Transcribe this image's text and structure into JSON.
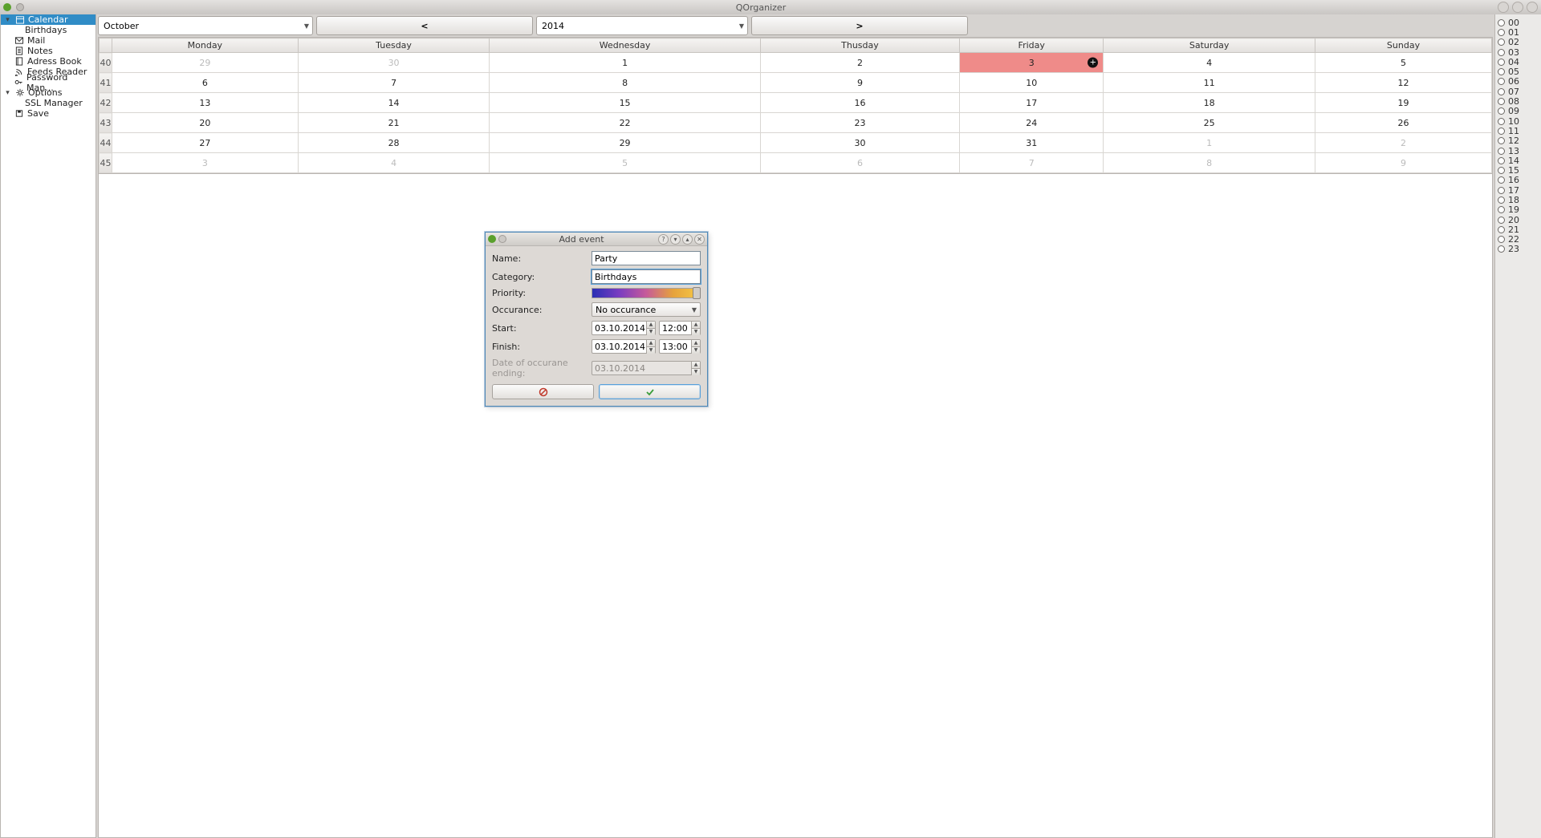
{
  "window": {
    "title": "QOrganizer"
  },
  "sidebar": {
    "items": [
      {
        "label": "Calendar",
        "icon": "calendar"
      },
      {
        "label": "Birthdays",
        "icon": ""
      },
      {
        "label": "Mail",
        "icon": "mail"
      },
      {
        "label": "Notes",
        "icon": "notes"
      },
      {
        "label": "Adress Book",
        "icon": "book"
      },
      {
        "label": "Feeds Reader",
        "icon": "feed"
      },
      {
        "label": "Password Man...",
        "icon": "key"
      },
      {
        "label": "Options",
        "icon": "gear"
      },
      {
        "label": "SSL Manager",
        "icon": ""
      },
      {
        "label": "Save",
        "icon": "save"
      }
    ]
  },
  "toolbar": {
    "month": "October",
    "prev": "<",
    "year": "2014",
    "next": ">"
  },
  "calendar": {
    "days": [
      "Monday",
      "Tuesday",
      "Wednesday",
      "Thusday",
      "Friday",
      "Saturday",
      "Sunday"
    ],
    "weeks": [
      {
        "wk": "40",
        "cells": [
          {
            "n": "29",
            "dim": true
          },
          {
            "n": "30",
            "dim": true
          },
          {
            "n": "1"
          },
          {
            "n": "2"
          },
          {
            "n": "3",
            "today": true,
            "badge": "+"
          },
          {
            "n": "4"
          },
          {
            "n": "5"
          }
        ]
      },
      {
        "wk": "41",
        "cells": [
          {
            "n": "6"
          },
          {
            "n": "7"
          },
          {
            "n": "8"
          },
          {
            "n": "9"
          },
          {
            "n": "10"
          },
          {
            "n": "11"
          },
          {
            "n": "12"
          }
        ]
      },
      {
        "wk": "42",
        "cells": [
          {
            "n": "13"
          },
          {
            "n": "14"
          },
          {
            "n": "15"
          },
          {
            "n": "16"
          },
          {
            "n": "17"
          },
          {
            "n": "18"
          },
          {
            "n": "19"
          }
        ]
      },
      {
        "wk": "43",
        "cells": [
          {
            "n": "20"
          },
          {
            "n": "21"
          },
          {
            "n": "22"
          },
          {
            "n": "23"
          },
          {
            "n": "24"
          },
          {
            "n": "25"
          },
          {
            "n": "26"
          }
        ]
      },
      {
        "wk": "44",
        "cells": [
          {
            "n": "27"
          },
          {
            "n": "28"
          },
          {
            "n": "29"
          },
          {
            "n": "30"
          },
          {
            "n": "31"
          },
          {
            "n": "1",
            "dim": true
          },
          {
            "n": "2",
            "dim": true
          }
        ]
      },
      {
        "wk": "45",
        "cells": [
          {
            "n": "3",
            "dim": true
          },
          {
            "n": "4",
            "dim": true
          },
          {
            "n": "5",
            "dim": true
          },
          {
            "n": "6",
            "dim": true
          },
          {
            "n": "7",
            "dim": true
          },
          {
            "n": "8",
            "dim": true
          },
          {
            "n": "9",
            "dim": true
          }
        ]
      }
    ]
  },
  "hours": [
    "00",
    "01",
    "02",
    "03",
    "04",
    "05",
    "06",
    "07",
    "08",
    "09",
    "10",
    "11",
    "12",
    "13",
    "14",
    "15",
    "16",
    "17",
    "18",
    "19",
    "20",
    "21",
    "22",
    "23"
  ],
  "dialog": {
    "title": "Add event",
    "labels": {
      "name": "Name:",
      "category": "Category:",
      "priority": "Priority:",
      "occurance": "Occurance:",
      "start": "Start:",
      "finish": "Finish:",
      "occur_end": "Date of occurane ending:"
    },
    "values": {
      "name": "Party",
      "category": "Birthdays",
      "occurance": "No occurance",
      "start_date": "03.10.2014",
      "start_time": "12:00",
      "finish_date": "03.10.2014",
      "finish_time": "13:00",
      "occur_end_date": "03.10.2014"
    }
  }
}
